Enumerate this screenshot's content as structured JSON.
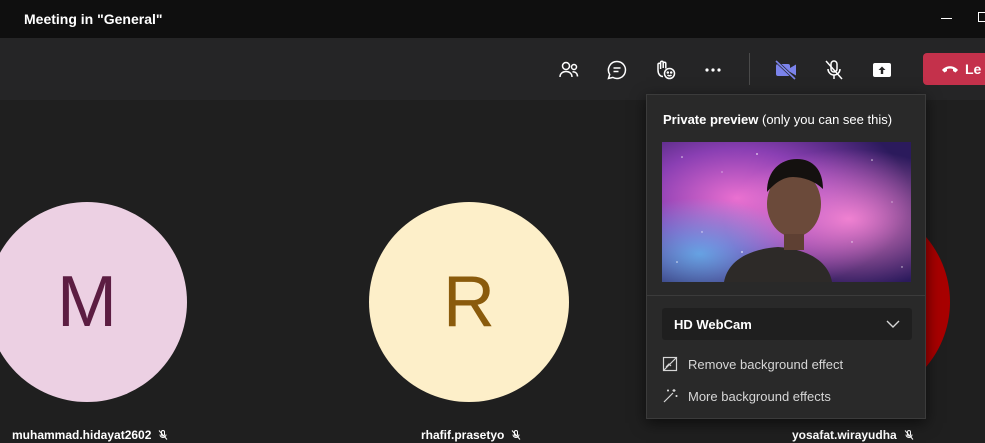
{
  "window": {
    "title": "Meeting in \"General\""
  },
  "toolbar": {
    "icons": [
      "people-icon",
      "chat-icon",
      "raise-hand-icon",
      "more-icon",
      "camera-off-icon",
      "mic-off-icon",
      "share-icon"
    ],
    "leave_label": "Le",
    "colors": {
      "accent": "#7b83eb",
      "leave": "#c4314b"
    }
  },
  "participants": [
    {
      "initial": "M",
      "name": "muhammad.hidayat2602",
      "bg": "#ecd0e3",
      "fg": "#5c1d42"
    },
    {
      "initial": "R",
      "name": "rhafif.prasetyo",
      "bg": "#fdefc9",
      "fg": "#8a5b0c"
    },
    {
      "initial": "",
      "name": "yosafat.wirayudha",
      "bg": "#a80000",
      "fg": "#ffffff"
    }
  ],
  "preview": {
    "title_bold": "Private preview",
    "title_rest": " (only you can see this)",
    "camera": "HD WebCam",
    "remove_bg": "Remove background effect",
    "more_bg": "More background effects"
  }
}
